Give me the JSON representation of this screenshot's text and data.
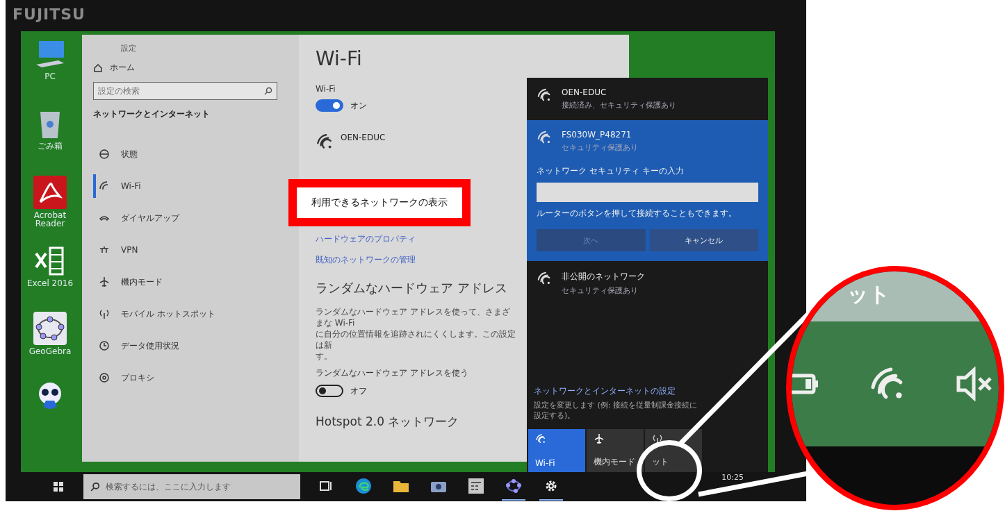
{
  "bezel": {
    "brand": "FUJITSU"
  },
  "desktop_icons": [
    {
      "kind": "pc",
      "label": "PC"
    },
    {
      "kind": "trash",
      "label": "ごみ箱"
    },
    {
      "kind": "acrobat",
      "label": "Acrobat Reader"
    },
    {
      "kind": "excel",
      "label": "Excel 2016"
    },
    {
      "kind": "geogebra",
      "label": "GeoGebra"
    },
    {
      "kind": "mascot"
    }
  ],
  "settings": {
    "title": "設定",
    "home": "ホーム",
    "search": {
      "placeholder": "設定の検索"
    },
    "section": "ネットワークとインターネット",
    "nav": [
      {
        "kind": "status",
        "label": "状態",
        "selected": false
      },
      {
        "kind": "wifi",
        "label": "Wi-Fi",
        "selected": true
      },
      {
        "kind": "dialup",
        "label": "ダイヤルアップ",
        "selected": false
      },
      {
        "kind": "vpn",
        "label": "VPN",
        "selected": false
      },
      {
        "kind": "airplane",
        "label": "機内モード",
        "selected": false
      },
      {
        "kind": "hotspot",
        "label": "モバイル ホットスポット",
        "selected": false
      },
      {
        "kind": "data",
        "label": "データ使用状況",
        "selected": false
      },
      {
        "kind": "proxy",
        "label": "プロキシ",
        "selected": false
      }
    ],
    "heading": "Wi-Fi",
    "wifi_label": "Wi-Fi",
    "wifi_toggle": {
      "on": true,
      "text": "オン"
    },
    "network": "OEN-EDUC",
    "links": [
      "ハードウェアのプロパティ",
      "既知のネットワークの管理"
    ],
    "random_heading": "ランダムなハードウェア アドレス",
    "random_text": [
      "ランダムなハードウェア アドレスを使って、さまざまな Wi-Fi",
      "に自分の位置情報を追跡されにくくします。この設定は新",
      "す。"
    ],
    "random_label": "ランダムなハードウェア アドレスを使う",
    "random_toggle": {
      "on": false,
      "text": "オフ"
    },
    "hotspot_heading": "Hotspot 2.0 ネットワーク"
  },
  "flyout": {
    "networks": [
      {
        "name": "OEN-EDUC",
        "status": "接続済み、セキュリティ保護あり",
        "selected": false
      },
      {
        "name": "FS030W_P48271",
        "status": "セキュリティ保護あり",
        "selected": true,
        "prompt": {
          "label": "ネットワーク セキュリティ キーの入力",
          "hint": "ルーターのボタンを押して接続することもできます。",
          "buttons": [
            {
              "label": "次へ",
              "disabled": true
            },
            {
              "label": "キャンセル",
              "disabled": false
            }
          ]
        }
      },
      {
        "name": "非公開のネットワーク",
        "status": "セキュリティ保護あり",
        "selected": false
      }
    ],
    "settings_link": {
      "title": "ネットワークとインターネットの設定",
      "description": "設定を変更します (例: 接続を従量制課金接続に設定する)。"
    },
    "tiles": [
      {
        "kind": "wifi",
        "label": "Wi-Fi",
        "on": true
      },
      {
        "kind": "airplane",
        "label": "機内モード",
        "on": false
      },
      {
        "kind": "hotspot",
        "label": "ット",
        "on": false
      }
    ]
  },
  "taskbar": {
    "search": {
      "placeholder": "検索するには、ここに入力します"
    },
    "apps": [
      {
        "kind": "taskview",
        "active": false
      },
      {
        "kind": "edge",
        "active": false
      },
      {
        "kind": "explorer",
        "active": false
      },
      {
        "kind": "camera",
        "active": false
      },
      {
        "kind": "calculator",
        "active": false
      },
      {
        "kind": "geogebra",
        "active": true
      },
      {
        "kind": "settings",
        "active": true
      }
    ],
    "clock": "10:25"
  },
  "callout": {
    "text": "利用できるネットワークの表示"
  },
  "magnifier": {
    "caption": "ット"
  }
}
